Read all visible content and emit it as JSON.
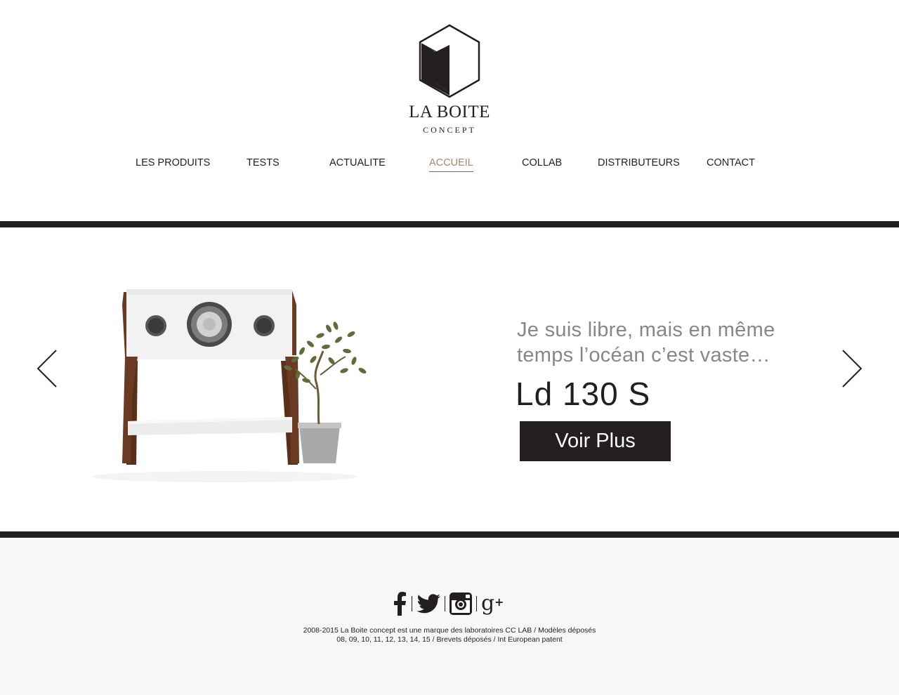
{
  "brand": {
    "name": "LA BOITE",
    "subtitle": "CONCEPT",
    "icon": "cube-hexagon-logo"
  },
  "nav": {
    "items": [
      {
        "label": "LES PRODUITS"
      },
      {
        "label": "TESTS"
      },
      {
        "label": "ACTUALITE"
      },
      {
        "label": "ACCUEIL",
        "active": true
      },
      {
        "label": "COLLAB"
      },
      {
        "label": "DISTRIBUTEURS"
      },
      {
        "label": "CONTACT"
      }
    ]
  },
  "hero": {
    "tagline_line1": "Je suis libre, mais en même",
    "tagline_line2": "temps l’océan c’est vaste…",
    "model": "Ld 130 S",
    "cta_label": "Voir Plus",
    "prev_icon": "chevron-left-icon",
    "next_icon": "chevron-right-icon",
    "image": "speaker-with-plant"
  },
  "footer": {
    "social": [
      "facebook-icon",
      "twitter-icon",
      "instagram-icon",
      "google-plus-icon"
    ],
    "copyright_line1": "2008-2015 La Boite concept est une marque des laboratoires CC LAB / Modèles déposés",
    "copyright_line2": "08, 09, 10, 11, 12, 13, 14, 15 / Brevets déposés / Int European patent"
  },
  "colors": {
    "dark": "#231f20",
    "active_nav": "#a88773",
    "tagline": "#8a8688",
    "footer_bg": "#f7f7f7",
    "wood": "#6b3a22"
  }
}
